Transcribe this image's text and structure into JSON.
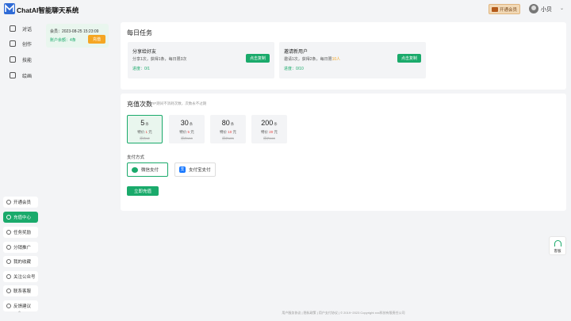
{
  "app": {
    "title": "ChatAI智能聊天系统"
  },
  "header": {
    "vip_label": "开通会员",
    "username": "小贝"
  },
  "nav": {
    "top_items": [
      {
        "label": "对话",
        "icon": "chat-icon"
      },
      {
        "label": "创作",
        "icon": "pen-icon"
      },
      {
        "label": "技能",
        "icon": "skill-icon"
      },
      {
        "label": "绘画",
        "icon": "palette-icon"
      }
    ],
    "bottom_items": [
      {
        "label": "开通会员",
        "icon": "diamond-icon"
      },
      {
        "label": "充值中心",
        "icon": "recharge-icon"
      },
      {
        "label": "任务奖励",
        "icon": "task-icon"
      },
      {
        "label": "分销推广",
        "icon": "share-icon"
      },
      {
        "label": "我的收藏",
        "icon": "star-icon"
      },
      {
        "label": "关注公众号",
        "icon": "follow-icon"
      },
      {
        "label": "联系客服",
        "icon": "service-icon"
      },
      {
        "label": "反馈建议",
        "icon": "feedback-icon"
      }
    ]
  },
  "account": {
    "member": "会员：2023-08-25 15:23:09",
    "balance_label": "账户余额：",
    "balance_value": "4条",
    "recharge_label": "充值"
  },
  "daily": {
    "title": "每日任务",
    "tasks": [
      {
        "title": "分享给好友",
        "desc": "分享1次，获得1条，每日限3次",
        "progress": "进度：0/1",
        "button": "点击复制"
      },
      {
        "title": "邀请新用户",
        "desc_pre": "邀请1次，获得2条，每日限",
        "desc_hl": "10人",
        "progress": "进度：0/10",
        "button": "点击复制"
      }
    ]
  },
  "recharge": {
    "title": "充值次数",
    "subtitle": "VIP期间不消耗次数，次数永不过期",
    "unit": "条",
    "packages": [
      {
        "count": "5",
        "price_pre": "特价 ",
        "price": "1",
        "price_unit": " 元",
        "orig": "原价¥2"
      },
      {
        "count": "30",
        "price_pre": "特价 ",
        "price": "5",
        "price_unit": " 元",
        "orig": "原价¥10"
      },
      {
        "count": "80",
        "price_pre": "特价 ",
        "price": "10",
        "price_unit": " 元",
        "orig": "原价¥25"
      },
      {
        "count": "200",
        "price_pre": "特价 ",
        "price": "20",
        "price_unit": " 元",
        "orig": "原价¥40"
      }
    ],
    "pay_label": "支付方式",
    "pay_methods": [
      {
        "label": "微信支付"
      },
      {
        "label": "支付宝支付"
      }
    ],
    "pay_now": "立即充值"
  },
  "service": {
    "label": "客服"
  },
  "footer": {
    "text": "用户服务协议 | 隐私政策 | 用户支付协议 | © 2019~2023 Copyright xxx科技有限责任公司"
  },
  "colors": {
    "accent": "#1aaa6b",
    "orange": "#f5a623",
    "price_red": "#e64340"
  }
}
